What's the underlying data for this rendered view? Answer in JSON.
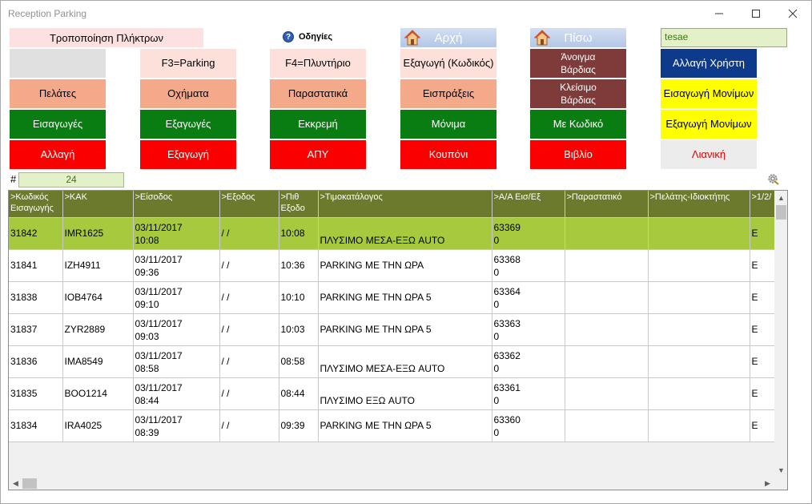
{
  "window": {
    "title": "Reception Parking"
  },
  "toolbar": {
    "keys_label": "Τροποποίηση Πλήκτρων",
    "help_label": "Οδηγίες",
    "home_label": "Αρχή",
    "back_label": "Πίσω",
    "user_value": "tesae"
  },
  "buttons": {
    "f3_parking": "F3=Parking",
    "f4_washer": "F4=Πλυντήριο",
    "export_code": "Εξαγωγή (Κωδικός)",
    "open_shift": "Άνοιγμα Βάρδιας",
    "change_user": "Αλλαγή Χρήστη",
    "customers": "Πελάτες",
    "vehicles": "Οχήματα",
    "documents": "Παραστατικά",
    "receipts": "Εισπράξεις",
    "close_shift": "Κλείσιμο Βάρδιας",
    "import_permanent": "Εισαγωγή Μονίμων",
    "imports": "Εισαγωγές",
    "exports": "Εξαγωγές",
    "pending": "Εκκρεμή",
    "permanent": "Μόνιμα",
    "with_code": "Με Κωδικό",
    "export_permanent": "Εξαγωγή Μονίμων",
    "change": "Αλλαγή",
    "export": "Εξαγωγή",
    "apy": "ΑΠΥ",
    "coupon": "Κουπόνι",
    "book": "Βιβλίο",
    "retail": "Λιανική"
  },
  "grid": {
    "count_label": "#",
    "count_value": "24",
    "columns": [
      ">Κωδικός Εισαγωγής",
      ">ΚΑΚ",
      ">Είσοδος",
      ">Εξοδος",
      ">Πιθ Εξοδο",
      ">Τιμοκατάλογος",
      ">Α/Α Εισ/Εξ",
      ">Παραστατικό",
      ">Πελάτης-Ιδιοκτήτης",
      ">1/2/"
    ],
    "rows": [
      {
        "code": "31842",
        "plate": "IMR1625",
        "entry_date": "03/11/2017",
        "entry_time": "10:08",
        "exit": " /  /",
        "expected_exit": "10:08",
        "price_list": "ΠΛΥΣΙΜΟ ΜΕΣΑ-ΕΞΩ AUTO",
        "seq": "63369",
        "seq2": "0",
        "document": "",
        "customer": "",
        "type": "E",
        "selected": true
      },
      {
        "code": "31841",
        "plate": "IZH4911",
        "entry_date": "03/11/2017",
        "entry_time": "09:36",
        "exit": " /  /",
        "expected_exit": "10:36",
        "price_list": "PARKING ΜΕ ΤΗΝ ΩΡΑ",
        "seq": "63368",
        "seq2": "0",
        "document": "",
        "customer": "",
        "type": "E",
        "selected": false
      },
      {
        "code": "31838",
        "plate": "IOB4764",
        "entry_date": "03/11/2017",
        "entry_time": "09:10",
        "exit": " /  /",
        "expected_exit": "10:10",
        "price_list": "PARKING ΜΕ ΤΗΝ ΩΡΑ 5",
        "seq": "63364",
        "seq2": "0",
        "document": "",
        "customer": "",
        "type": "E",
        "selected": false
      },
      {
        "code": "31837",
        "plate": "ZYR2889",
        "entry_date": "03/11/2017",
        "entry_time": "09:03",
        "exit": " /  /",
        "expected_exit": "10:03",
        "price_list": "PARKING ΜΕ ΤΗΝ ΩΡΑ 5",
        "seq": "63363",
        "seq2": "0",
        "document": "",
        "customer": "",
        "type": "E",
        "selected": false
      },
      {
        "code": "31836",
        "plate": "IMA8549",
        "entry_date": "03/11/2017",
        "entry_time": "08:58",
        "exit": " /  /",
        "expected_exit": "08:58",
        "price_list": "ΠΛΥΣΙΜΟ ΜΕΣΑ-ΕΞΩ AUTO",
        "seq": "63362",
        "seq2": "0",
        "document": "",
        "customer": "",
        "type": "E",
        "selected": false
      },
      {
        "code": "31835",
        "plate": "BOO1214",
        "entry_date": "03/11/2017",
        "entry_time": "08:44",
        "exit": " /  /",
        "expected_exit": "08:44",
        "price_list": "ΠΛΥΣΙΜΟ ΕΞΩ AUTO",
        "seq": "63361",
        "seq2": "0",
        "document": "",
        "customer": "",
        "type": "E",
        "selected": false
      },
      {
        "code": "31834",
        "plate": "IRA4025",
        "entry_date": "03/11/2017",
        "entry_time": "08:39",
        "exit": " /  /",
        "expected_exit": "09:39",
        "price_list": "PARKING ΜΕ ΤΗΝ ΩΡΑ 5",
        "seq": "63360",
        "seq2": "0",
        "document": "",
        "customer": "",
        "type": "E",
        "selected": false
      }
    ]
  },
  "colors": {
    "header_bg": "#6b7a2c",
    "selected_row": "#a6c93d",
    "green_button": "#0a7d12",
    "red_button": "#fb0000",
    "salmon_button": "#f4a98a",
    "navy_button": "#0e3a8c",
    "maroon_button": "#7f3a3a"
  }
}
